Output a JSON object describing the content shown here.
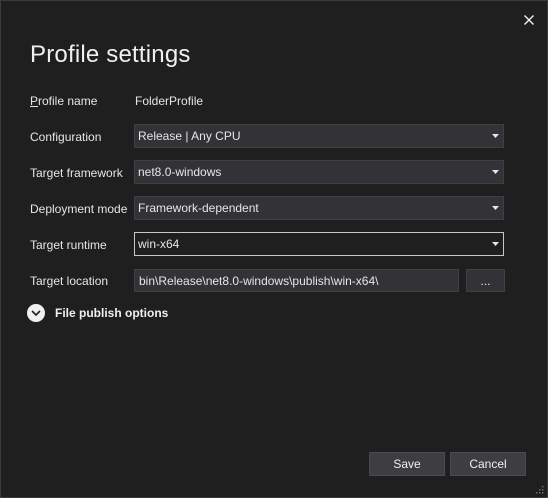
{
  "dialog": {
    "title": "Profile settings",
    "close_icon": "close-icon"
  },
  "fields": {
    "profile_name": {
      "label_accel": "P",
      "label_rest": "rofile name",
      "value": "FolderProfile"
    },
    "configuration": {
      "label": "Configuration",
      "value": "Release | Any CPU"
    },
    "target_framework": {
      "label": "Target framework",
      "value": "net8.0-windows"
    },
    "deployment_mode": {
      "label": "Deployment mode",
      "value": "Framework-dependent"
    },
    "target_runtime": {
      "label": "Target runtime",
      "value": "win-x64"
    },
    "target_location": {
      "label": "Target location",
      "value": "bin\\Release\\net8.0-windows\\publish\\win-x64\\",
      "browse_label": "..."
    }
  },
  "expander": {
    "label": "File publish options",
    "icon": "chevron-down-icon"
  },
  "footer": {
    "save_label": "Save",
    "cancel_label": "Cancel"
  },
  "colors": {
    "background": "#1f1f1f",
    "input_background": "#333337",
    "button_background": "#3e3e42",
    "text": "#e6e6e6",
    "focus_border": "#c8c8c8"
  }
}
